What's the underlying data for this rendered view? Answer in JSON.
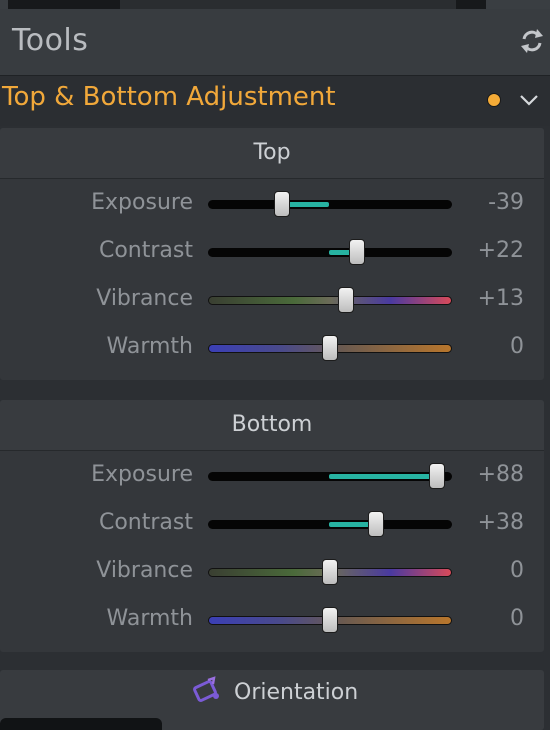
{
  "header": {
    "title": "Tools",
    "refresh_icon": "refresh-icon"
  },
  "section": {
    "title": "Top & Bottom Adjustment",
    "status_color": "#f4ab37",
    "accent": "#f1a83a"
  },
  "groups": [
    {
      "title": "Top",
      "rows": [
        {
          "label": "Exposure",
          "value": "-39",
          "level": -39,
          "track": "plain"
        },
        {
          "label": "Contrast",
          "value": "+22",
          "level": 22,
          "track": "plain"
        },
        {
          "label": "Vibrance",
          "value": "+13",
          "level": 13,
          "track": "vibrance"
        },
        {
          "label": "Warmth",
          "value": "0",
          "level": 0,
          "track": "warmth"
        }
      ]
    },
    {
      "title": "Bottom",
      "rows": [
        {
          "label": "Exposure",
          "value": "+88",
          "level": 88,
          "track": "plain"
        },
        {
          "label": "Contrast",
          "value": "+38",
          "level": 38,
          "track": "plain"
        },
        {
          "label": "Vibrance",
          "value": "0",
          "level": 0,
          "track": "vibrance"
        },
        {
          "label": "Warmth",
          "value": "0",
          "level": 0,
          "track": "warmth"
        }
      ]
    }
  ],
  "next_section": {
    "title": "Orientation"
  },
  "colors": {
    "fill": "#27b3a2",
    "panel": "#34373b",
    "background": "#2c2f33"
  }
}
